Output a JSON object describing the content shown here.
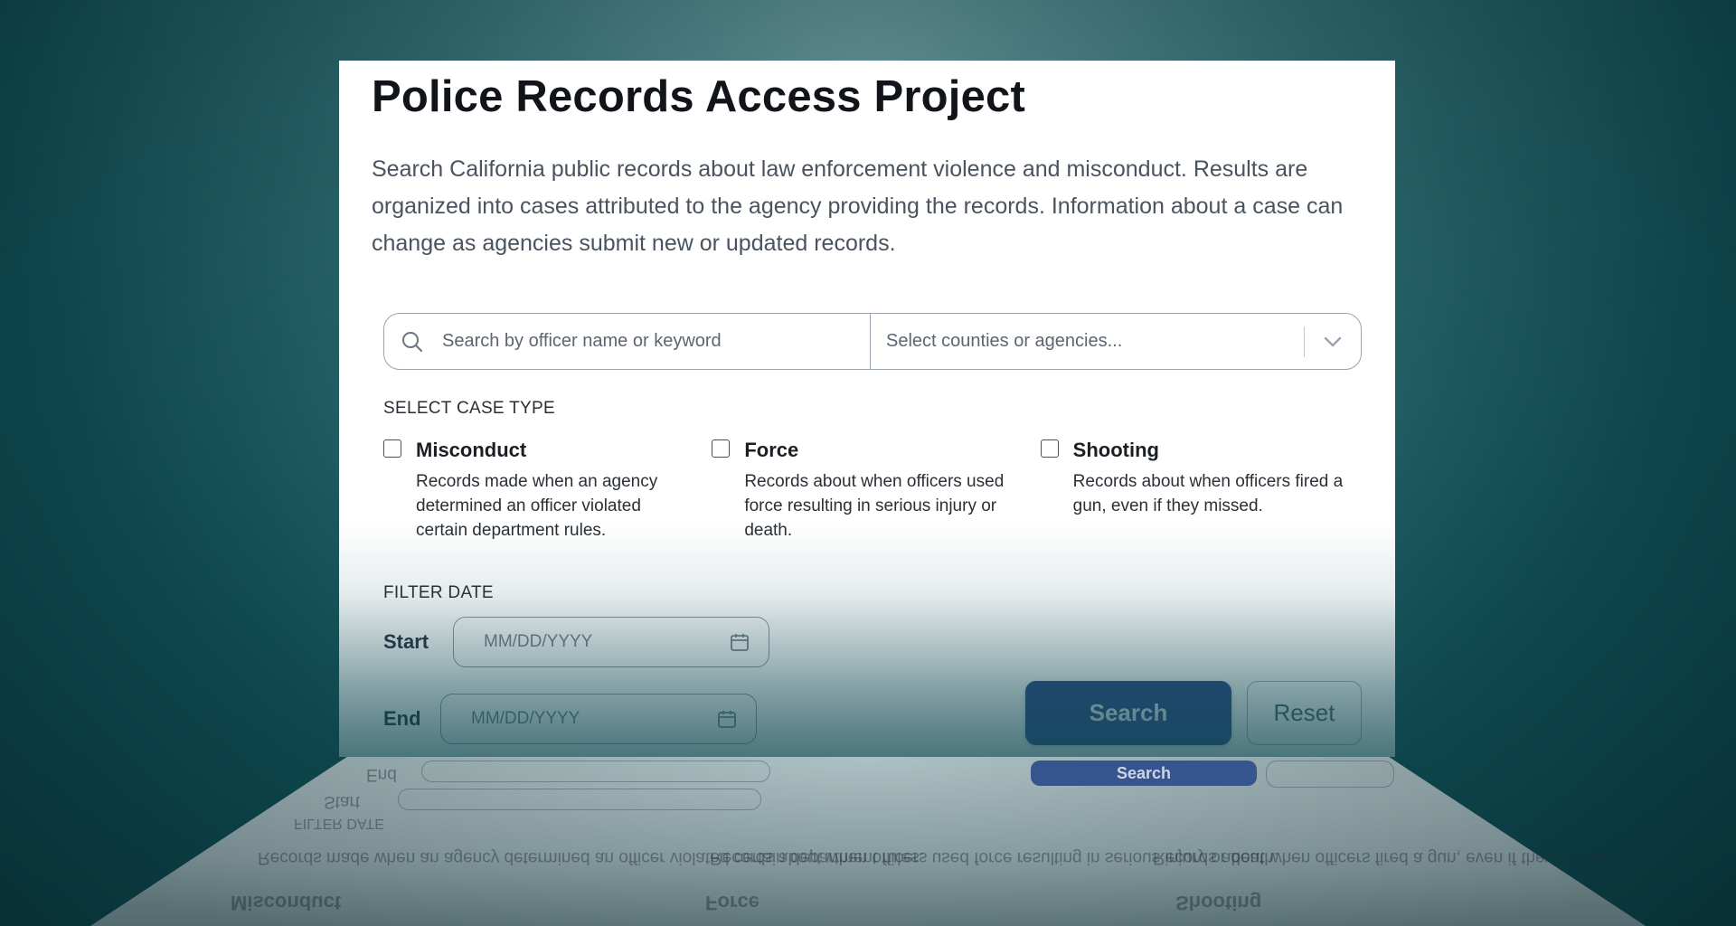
{
  "header": {
    "title": "Police Records Access Project",
    "intro": "Search California public records about law enforcement violence and misconduct. Results are organized into cases attributed to the agency providing the records. Information about a case can change as agencies submit new or updated records."
  },
  "search": {
    "placeholder": "Search by officer name or keyword",
    "value": "",
    "agency_placeholder": "Select counties or agencies..."
  },
  "case_type": {
    "label": "SELECT CASE TYPE",
    "options": [
      {
        "name": "Misconduct",
        "description": "Records made when an agency determined an officer violated certain department rules.",
        "checked": false
      },
      {
        "name": "Force",
        "description": "Records about when officers used force resulting in serious injury or death.",
        "checked": false
      },
      {
        "name": "Shooting",
        "description": "Records about when officers fired a gun, even if they missed.",
        "checked": false
      }
    ]
  },
  "filter_date": {
    "label": "FILTER DATE",
    "start_label": "Start",
    "end_label": "End",
    "start_placeholder": "MM/DD/YYYY",
    "end_placeholder": "MM/DD/YYYY"
  },
  "actions": {
    "search_label": "Search",
    "reset_label": "Reset"
  },
  "colors": {
    "primary_button": "#2f4c8a",
    "background": "#1f5e66"
  },
  "icons": [
    "search-icon",
    "chevron-down-icon",
    "calendar-icon"
  ]
}
